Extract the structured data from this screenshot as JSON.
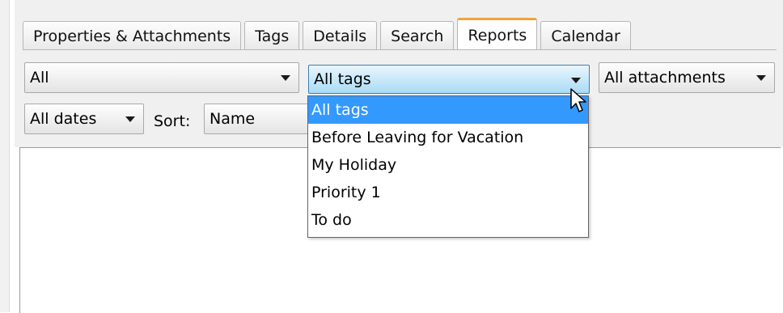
{
  "tabs": [
    {
      "label": "Properties & Attachments"
    },
    {
      "label": "Tags"
    },
    {
      "label": "Details"
    },
    {
      "label": "Search"
    },
    {
      "label": "Reports",
      "active": true
    },
    {
      "label": "Calendar"
    }
  ],
  "filters": {
    "scope": "All",
    "tags": "All tags",
    "attachments": "All attachments",
    "dates": "All dates",
    "sort_label": "Sort:",
    "sort": "Name"
  },
  "tags_dropdown": {
    "options": [
      "All tags",
      "Before Leaving for Vacation",
      "My Holiday",
      "Priority 1",
      "To do"
    ],
    "selected_index": 0
  },
  "colors": {
    "active_tab_accent": "#f0a43a",
    "selection": "#3399ff"
  }
}
